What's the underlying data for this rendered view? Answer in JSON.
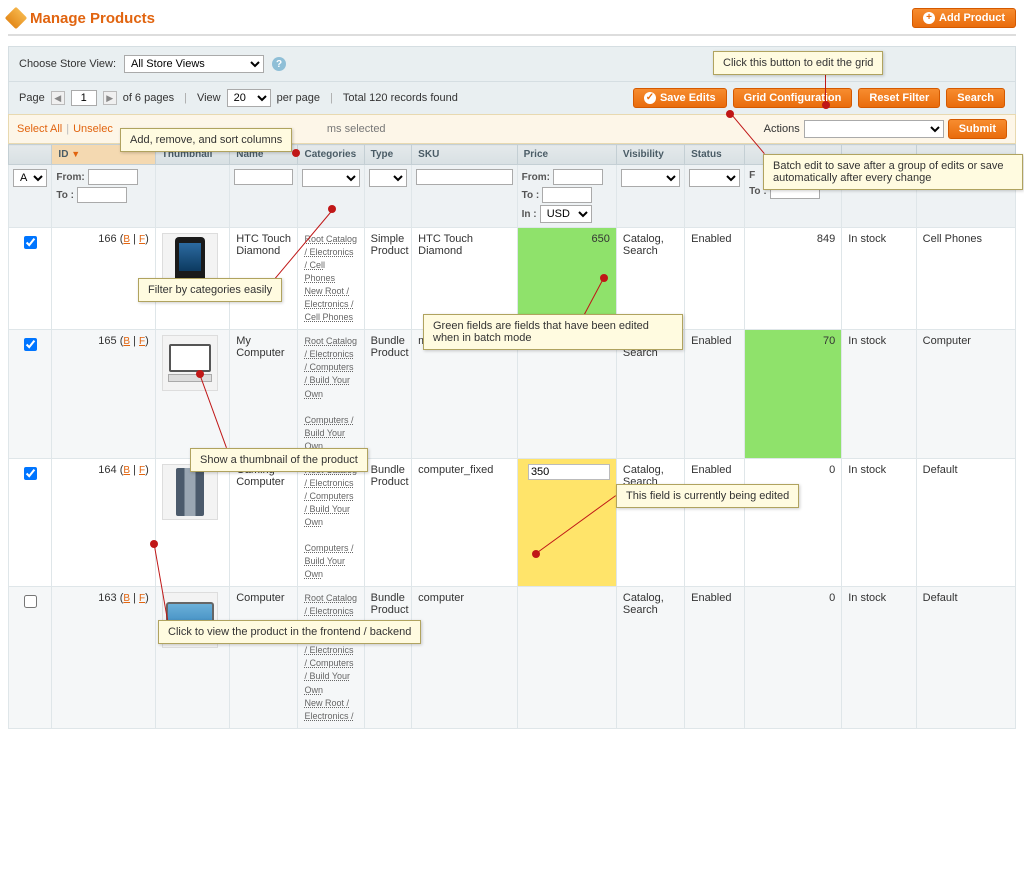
{
  "page": {
    "title": "Manage Products",
    "add_button": "Add Product"
  },
  "storeview": {
    "label": "Choose Store View:",
    "value": "All Store Views"
  },
  "pager": {
    "page_label": "Page",
    "page_value": "1",
    "of_pages_text": "of 6 pages",
    "view_label": "View",
    "perpage_value": "20",
    "perpage_label": "per page",
    "total_text": "Total 120 records found",
    "save_edits": "Save Edits",
    "grid_config": "Grid Configuration",
    "reset_filter": "Reset Filter",
    "search": "Search"
  },
  "selectrow": {
    "select_all": "Select All",
    "unselect_partial": "Unselec",
    "items_selected_partial": "ms selected",
    "actions_label": "Actions",
    "submit": "Submit"
  },
  "columns": {
    "checkbox": "",
    "id": "ID",
    "thumbnail": "Thumbnail",
    "name": "Name",
    "categories": "Categories",
    "type": "Type",
    "sku": "SKU",
    "price": "Price",
    "visibility": "Visibility",
    "status": "Status",
    "qty": "",
    "stock": "",
    "attrset": ""
  },
  "filters": {
    "any": "Any",
    "from": "From:",
    "to": "To :",
    "in": "In :",
    "usd": "USD"
  },
  "rows": [
    {
      "id": "166",
      "name": "HTC Touch Diamond",
      "categories": "Root Catalog / Electronics / Cell Phones\nNew Root / Electronics / Cell Phones",
      "type": "Simple Product",
      "sku": "HTC Touch Diamond",
      "price": "650",
      "visibility": "Catalog, Search",
      "status": "Enabled",
      "qty": "849",
      "stock": "In stock",
      "attrset": "Cell Phones",
      "checked": true,
      "thumb": "phone",
      "price_edited": true,
      "qty_edited": false,
      "editing": false
    },
    {
      "id": "165",
      "name": "My Computer",
      "categories": "Root Catalog / Electronics / Computers / Build Your Own\n\nComputers / Build Your Own",
      "type": "Bundle Product",
      "sku": "mycomputer",
      "price": "",
      "visibility": "Catalog, Search",
      "status": "Enabled",
      "qty": "70",
      "stock": "In stock",
      "attrset": "Computer",
      "checked": true,
      "thumb": "monitor",
      "price_edited": false,
      "qty_edited": true,
      "editing": false
    },
    {
      "id": "164",
      "name": "Gaming Computer",
      "categories": "Root Catalog / Electronics / Computers / Build Your Own\n\nComputers / Build Your Own",
      "type": "Bundle Product",
      "sku": "computer_fixed",
      "price": "350",
      "visibility": "Catalog, Search",
      "status": "Enabled",
      "qty": "0",
      "stock": "In stock",
      "attrset": "Default",
      "checked": true,
      "thumb": "tower",
      "price_edited": false,
      "qty_edited": false,
      "editing": true
    },
    {
      "id": "163",
      "name": "Computer",
      "categories": "Root Catalog / Electronics / Computers\nRoot Catalog / Electronics / Computers / Build Your Own\nNew Root / Electronics /",
      "type": "Bundle Product",
      "sku": "computer",
      "price": "",
      "visibility": "Catalog, Search",
      "status": "Enabled",
      "qty": "0",
      "stock": "In stock",
      "attrset": "Default",
      "checked": false,
      "thumb": "imac",
      "price_edited": false,
      "qty_edited": false,
      "editing": false
    }
  ],
  "callouts": {
    "c1": "Click this button to edit the grid",
    "c2": "Add, remove, and sort columns",
    "c3": "Batch edit to save after a group of edits or save automatically after every change",
    "c4": "Filter by categories easily",
    "c5": "Green fields are fields that have been edited when in batch mode",
    "c6": "Show a thumbnail of the product",
    "c7": "This field is currently being edited",
    "c8": "Click to view the product in the frontend / backend"
  }
}
